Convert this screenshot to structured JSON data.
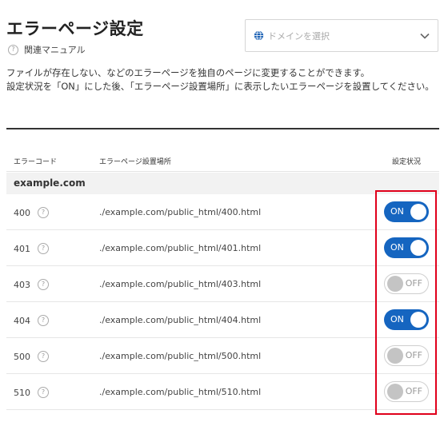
{
  "page": {
    "title": "エラーページ設定",
    "manual_link": "関連マニュアル",
    "domain_placeholder": "ドメインを選択",
    "description": "ファイルが存在しない、などのエラーページを独自のページに変更することができます。\n設定状況を「ON」にした後、「エラーページ設置場所」に表示したいエラーページを設置してください。"
  },
  "table": {
    "headers": {
      "code": "エラーコード",
      "path": "エラーページ設置場所",
      "status": "設定状況"
    },
    "group": "example.com",
    "rows": [
      {
        "code": "400",
        "path": "./example.com/public_html/400.html",
        "status": "ON"
      },
      {
        "code": "401",
        "path": "./example.com/public_html/401.html",
        "status": "ON"
      },
      {
        "code": "403",
        "path": "./example.com/public_html/403.html",
        "status": "OFF"
      },
      {
        "code": "404",
        "path": "./example.com/public_html/404.html",
        "status": "ON"
      },
      {
        "code": "500",
        "path": "./example.com/public_html/500.html",
        "status": "OFF"
      },
      {
        "code": "510",
        "path": "./example.com/public_html/510.html",
        "status": "OFF"
      }
    ]
  },
  "colors": {
    "toggle_on": "#1565c0",
    "highlight": "#e0001b"
  },
  "icons": {
    "help": "question-circle-icon",
    "domain": "globe-icon",
    "dropdown": "chevron-down-icon"
  }
}
